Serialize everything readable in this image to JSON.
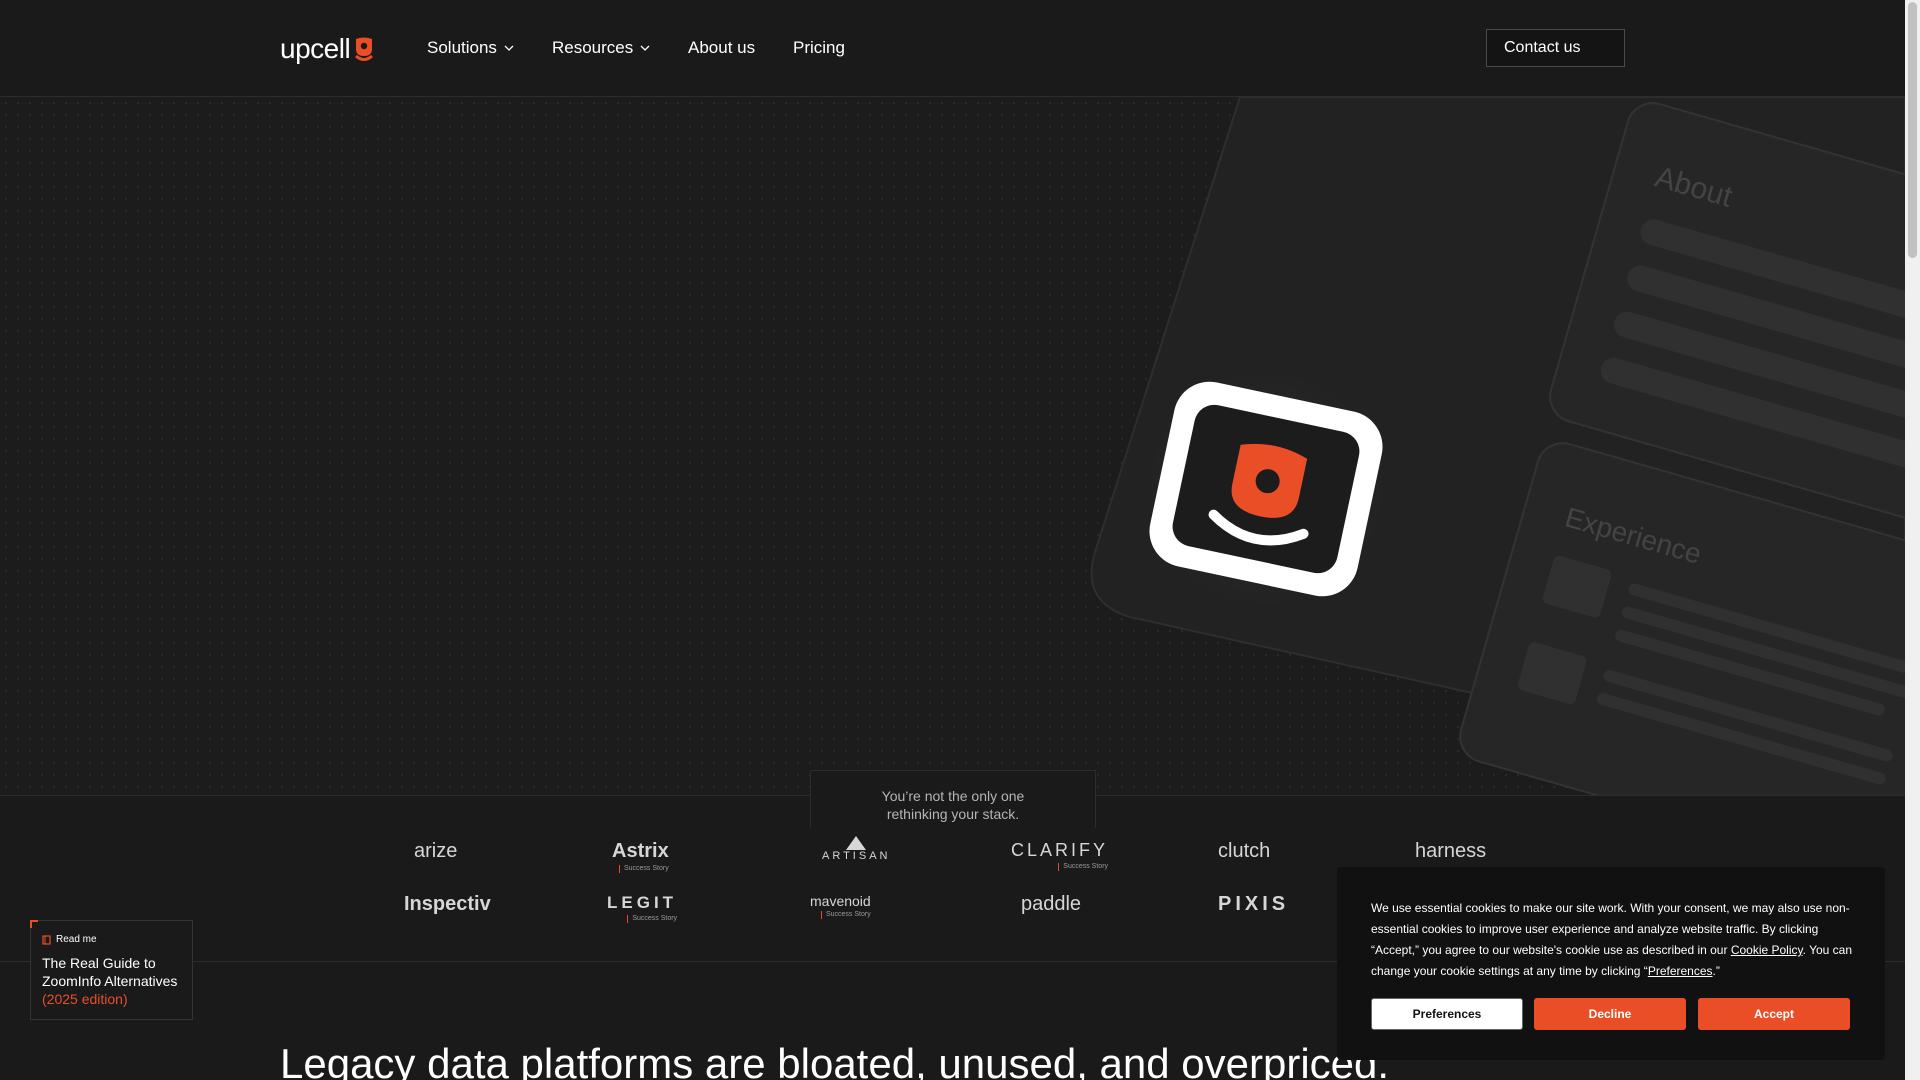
{
  "brand": {
    "logo_text": "upcell",
    "accent": "#ea4e27"
  },
  "nav": {
    "items": [
      {
        "label": "Solutions",
        "dropdown": true
      },
      {
        "label": "Resources",
        "dropdown": true
      },
      {
        "label": "About us",
        "dropdown": false
      },
      {
        "label": "Pricing",
        "dropdown": false
      }
    ],
    "contact_label": "Contact us"
  },
  "hero": {
    "card_about_label": "About",
    "card_experience_label": "Experience"
  },
  "logos": {
    "tagline_line1": "You’re not the only one",
    "tagline_line2": "rethinking your stack.",
    "success_story_label": "Success Story",
    "row1": [
      "arize",
      "Astrix",
      "ARTISAN",
      "CLARIFY",
      "clutch",
      "harness"
    ],
    "row2": [
      "Inspectiv",
      "LEGIT",
      "mavenoid",
      "paddle",
      "PIXIS"
    ]
  },
  "readme": {
    "tag": "Read me",
    "title": "The Real Guide to ZoomInfo Alternatives",
    "edition": "(2025 edition)"
  },
  "headline": "Legacy data platforms are bloated, unused, and overpriced.",
  "cookie": {
    "text_before_policy": "We use essential cookies to make our site work. With your consent, we may also use non-essential cookies to improve user experience and analyze website traffic. By clicking “Accept,” you agree to our website's cookie use as described in our ",
    "policy_link": "Cookie Policy",
    "text_mid": ". You can change your cookie settings at any time by clicking “",
    "preferences_link": "Preferences",
    "text_end": ".”",
    "buttons": {
      "preferences": "Preferences",
      "decline": "Decline",
      "accept": "Accept"
    }
  }
}
